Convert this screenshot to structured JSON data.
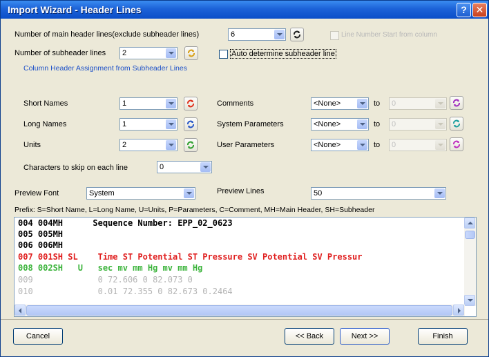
{
  "window": {
    "title": "Import Wizard - Header Lines"
  },
  "main_header": {
    "label": "Number of main header lines(exclude subheader lines)",
    "value": "6",
    "line_number_label": "Line Number Start from column"
  },
  "subheader": {
    "label": "Number of subheader lines",
    "value": "2",
    "auto_label": "Auto determine subheader line"
  },
  "assignment": {
    "title": "Column Header Assignment from Subheader Lines",
    "short_names": {
      "label": "Short Names",
      "value": "1"
    },
    "long_names": {
      "label": "Long Names",
      "value": "1"
    },
    "units": {
      "label": "Units",
      "value": "2"
    },
    "comments": {
      "label": "Comments",
      "value": "<None>",
      "to": "to",
      "to_value": "0"
    },
    "system_params": {
      "label": "System Parameters",
      "value": "<None>",
      "to": "to",
      "to_value": "0"
    },
    "user_params": {
      "label": "User Parameters",
      "value": "<None>",
      "to": "to",
      "to_value": "0"
    }
  },
  "skip": {
    "label": "Characters to skip on each line",
    "value": "0"
  },
  "preview_font": {
    "label": "Preview Font",
    "value": "System"
  },
  "preview_lines": {
    "label": "Preview Lines",
    "value": "50"
  },
  "prefix_text": "Prefix:  S=Short Name, L=Long Name, U=Units, P=Parameters, C=Comment, MH=Main Header, SH=Subheader",
  "preview": {
    "lines": [
      {
        "text": "004 004MH      Sequence Number: EPP_02_0623",
        "color": "#000000"
      },
      {
        "text": "005 005MH",
        "color": "#000000"
      },
      {
        "text": "006 006MH",
        "color": "#000000"
      },
      {
        "text": "007 001SH SL    Time ST Potential ST Pressure SV Potential SV Pressur",
        "color": "#e02020"
      },
      {
        "text": "008 002SH   U   sec mv mm Hg mv mm Hg",
        "color": "#3cb43c"
      },
      {
        "text": "009             0 72.606 0 82.073 0",
        "color": "#b4b4b4"
      },
      {
        "text": "010             0.01 72.355 0 82.673 0.2464",
        "color": "#b4b4b4"
      }
    ]
  },
  "buttons": {
    "cancel": "Cancel",
    "back": "<< Back",
    "next": "Next >>",
    "finish": "Finish"
  },
  "colors": {
    "accent": "#1c50c8",
    "mainheader": "#000000",
    "subheader_sl": "#e02020",
    "subheader_u": "#3cb43c",
    "data": "#b4b4b4"
  }
}
